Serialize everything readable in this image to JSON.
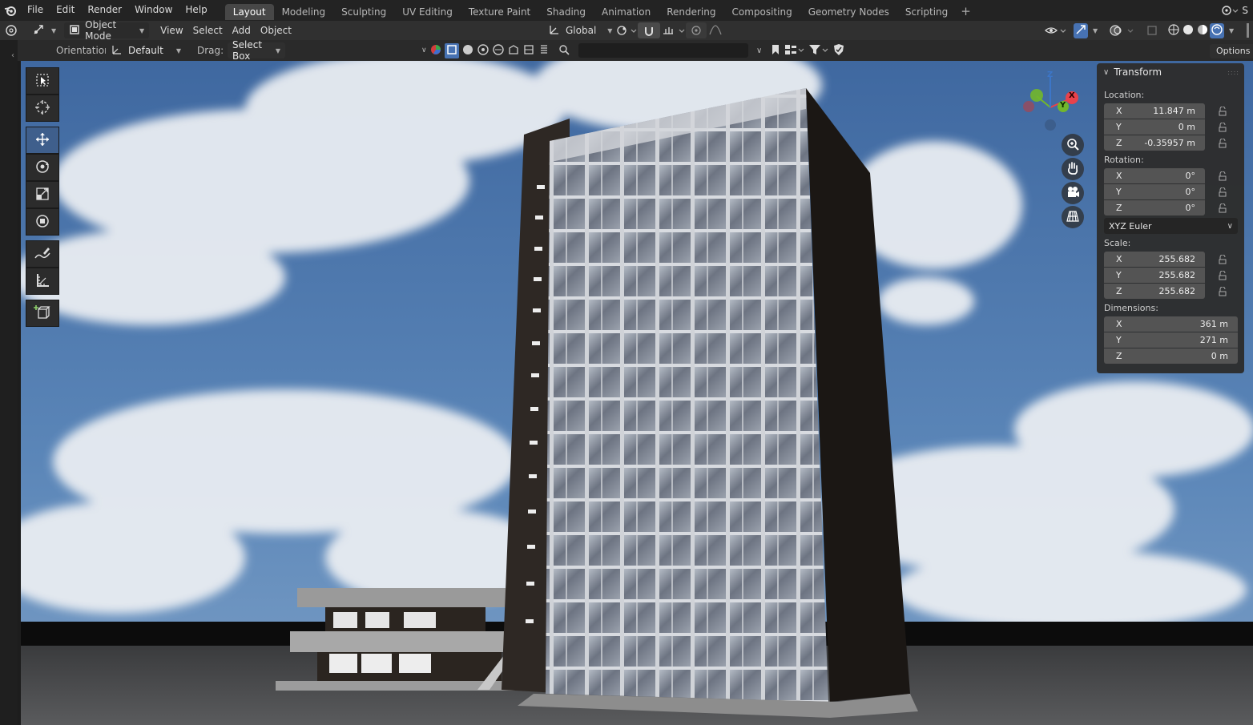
{
  "menubar": {
    "items": [
      "File",
      "Edit",
      "Render",
      "Window",
      "Help"
    ],
    "workspaces": [
      "Layout",
      "Modeling",
      "Sculpting",
      "UV Editing",
      "Texture Paint",
      "Shading",
      "Animation",
      "Rendering",
      "Compositing",
      "Geometry Nodes",
      "Scripting"
    ],
    "active_workspace": "Layout",
    "add_tab": "+",
    "right_text": "S"
  },
  "header": {
    "mode": "Object Mode",
    "menus": [
      "View",
      "Select",
      "Add",
      "Object"
    ],
    "transform_orientation": "Global"
  },
  "tool_settings": {
    "orientation_label": "Orientation:",
    "orientation_value": "Default",
    "drag_label": "Drag:",
    "drag_value": "Select Box",
    "options": "Options"
  },
  "toolbar": {
    "tools": [
      "select-box",
      "cursor",
      "move",
      "rotate",
      "scale",
      "transform",
      "annotate",
      "measure",
      "add-cube"
    ],
    "active": "move"
  },
  "gizmo": {
    "x": "X",
    "y": "Y",
    "z": "Z"
  },
  "transform": {
    "title": "Transform",
    "location_label": "Location:",
    "location": [
      {
        "axis": "X",
        "value": "11.847 m"
      },
      {
        "axis": "Y",
        "value": "0 m"
      },
      {
        "axis": "Z",
        "value": "-0.35957 m"
      }
    ],
    "rotation_label": "Rotation:",
    "rotation": [
      {
        "axis": "X",
        "value": "0°"
      },
      {
        "axis": "Y",
        "value": "0°"
      },
      {
        "axis": "Z",
        "value": "0°"
      }
    ],
    "rotation_mode": "XYZ Euler",
    "scale_label": "Scale:",
    "scale": [
      {
        "axis": "X",
        "value": "255.682"
      },
      {
        "axis": "Y",
        "value": "255.682"
      },
      {
        "axis": "Z",
        "value": "255.682"
      }
    ],
    "dimensions_label": "Dimensions:",
    "dimensions": [
      {
        "axis": "X",
        "value": "361 m"
      },
      {
        "axis": "Y",
        "value": "271 m"
      },
      {
        "axis": "Z",
        "value": "0 m"
      }
    ]
  },
  "colors": {
    "active_blue": "#3f5f8c",
    "axis_x": "#e8424b",
    "axis_y": "#72b72b",
    "axis_z": "#3c76c8"
  }
}
